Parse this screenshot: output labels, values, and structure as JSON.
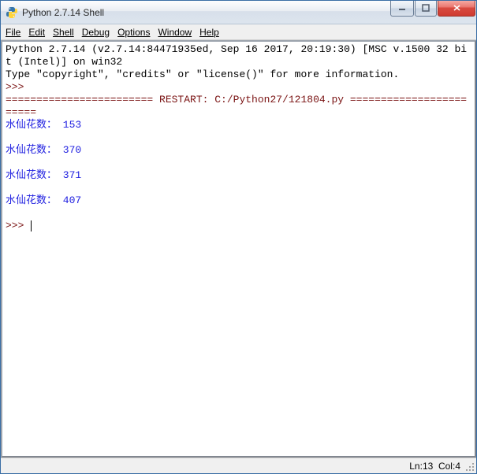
{
  "window": {
    "title": "Python 2.7.14 Shell"
  },
  "menu": {
    "file": "File",
    "edit": "Edit",
    "shell": "Shell",
    "debug": "Debug",
    "options": "Options",
    "window": "Window",
    "help": "Help"
  },
  "shell": {
    "banner_line1": "Python 2.7.14 (v2.7.14:84471935ed, Sep 16 2017, 20:19:30) [MSC v.1500 32 bit (Intel)] on win32",
    "banner_line2": "Type \"copyright\", \"credits\" or \"license()\" for more information.",
    "prompt": ">>> ",
    "restart_line": "======================== RESTART: C:/Python27/121804.py ========================",
    "outputs": [
      "水仙花数： 153",
      "水仙花数： 370",
      "水仙花数： 371",
      "水仙花数： 407"
    ]
  },
  "status": {
    "ln_label": "Ln: ",
    "ln_value": "13",
    "col_label": "Col: ",
    "col_value": "4"
  }
}
